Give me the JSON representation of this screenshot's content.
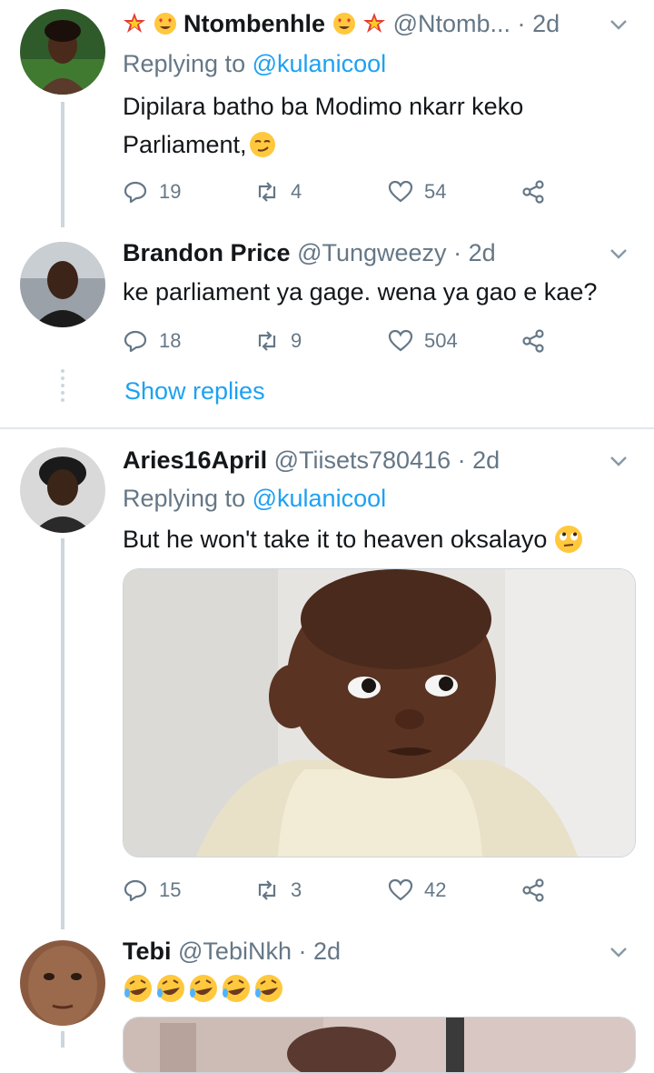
{
  "tweets": [
    {
      "name": "Ntombenhle",
      "handle": "@Ntomb...",
      "sep": "·",
      "time": "2d",
      "replying_prefix": "Replying to",
      "replying_handle": "@kulanicool",
      "text_line1": "Dipilara batho ba Modimo nkarr keko",
      "text_line2": "Parliament,",
      "replies": "19",
      "retweets": "4",
      "likes": "54"
    },
    {
      "name": "Brandon Price",
      "handle": "@Tungweezy",
      "sep": "·",
      "time": "2d",
      "text": "ke parliament ya gage. wena ya gao e kae?",
      "replies": "18",
      "retweets": "9",
      "likes": "504"
    },
    {
      "name": "Aries16April",
      "handle": "@Tiisets780416",
      "sep": "·",
      "time": "2d",
      "replying_prefix": "Replying to",
      "replying_handle": "@kulanicool",
      "text": "But he won't take it to heaven oksalayo",
      "replies": "15",
      "retweets": "3",
      "likes": "42"
    },
    {
      "name": "Tebi",
      "handle": "@TebiNkh",
      "sep": "·",
      "time": "2d"
    }
  ],
  "show_replies": "Show replies",
  "colors": {
    "link": "#1da1f2",
    "muted": "#657786",
    "thread": "#ccd6dd",
    "divider": "#e1e8ed"
  }
}
